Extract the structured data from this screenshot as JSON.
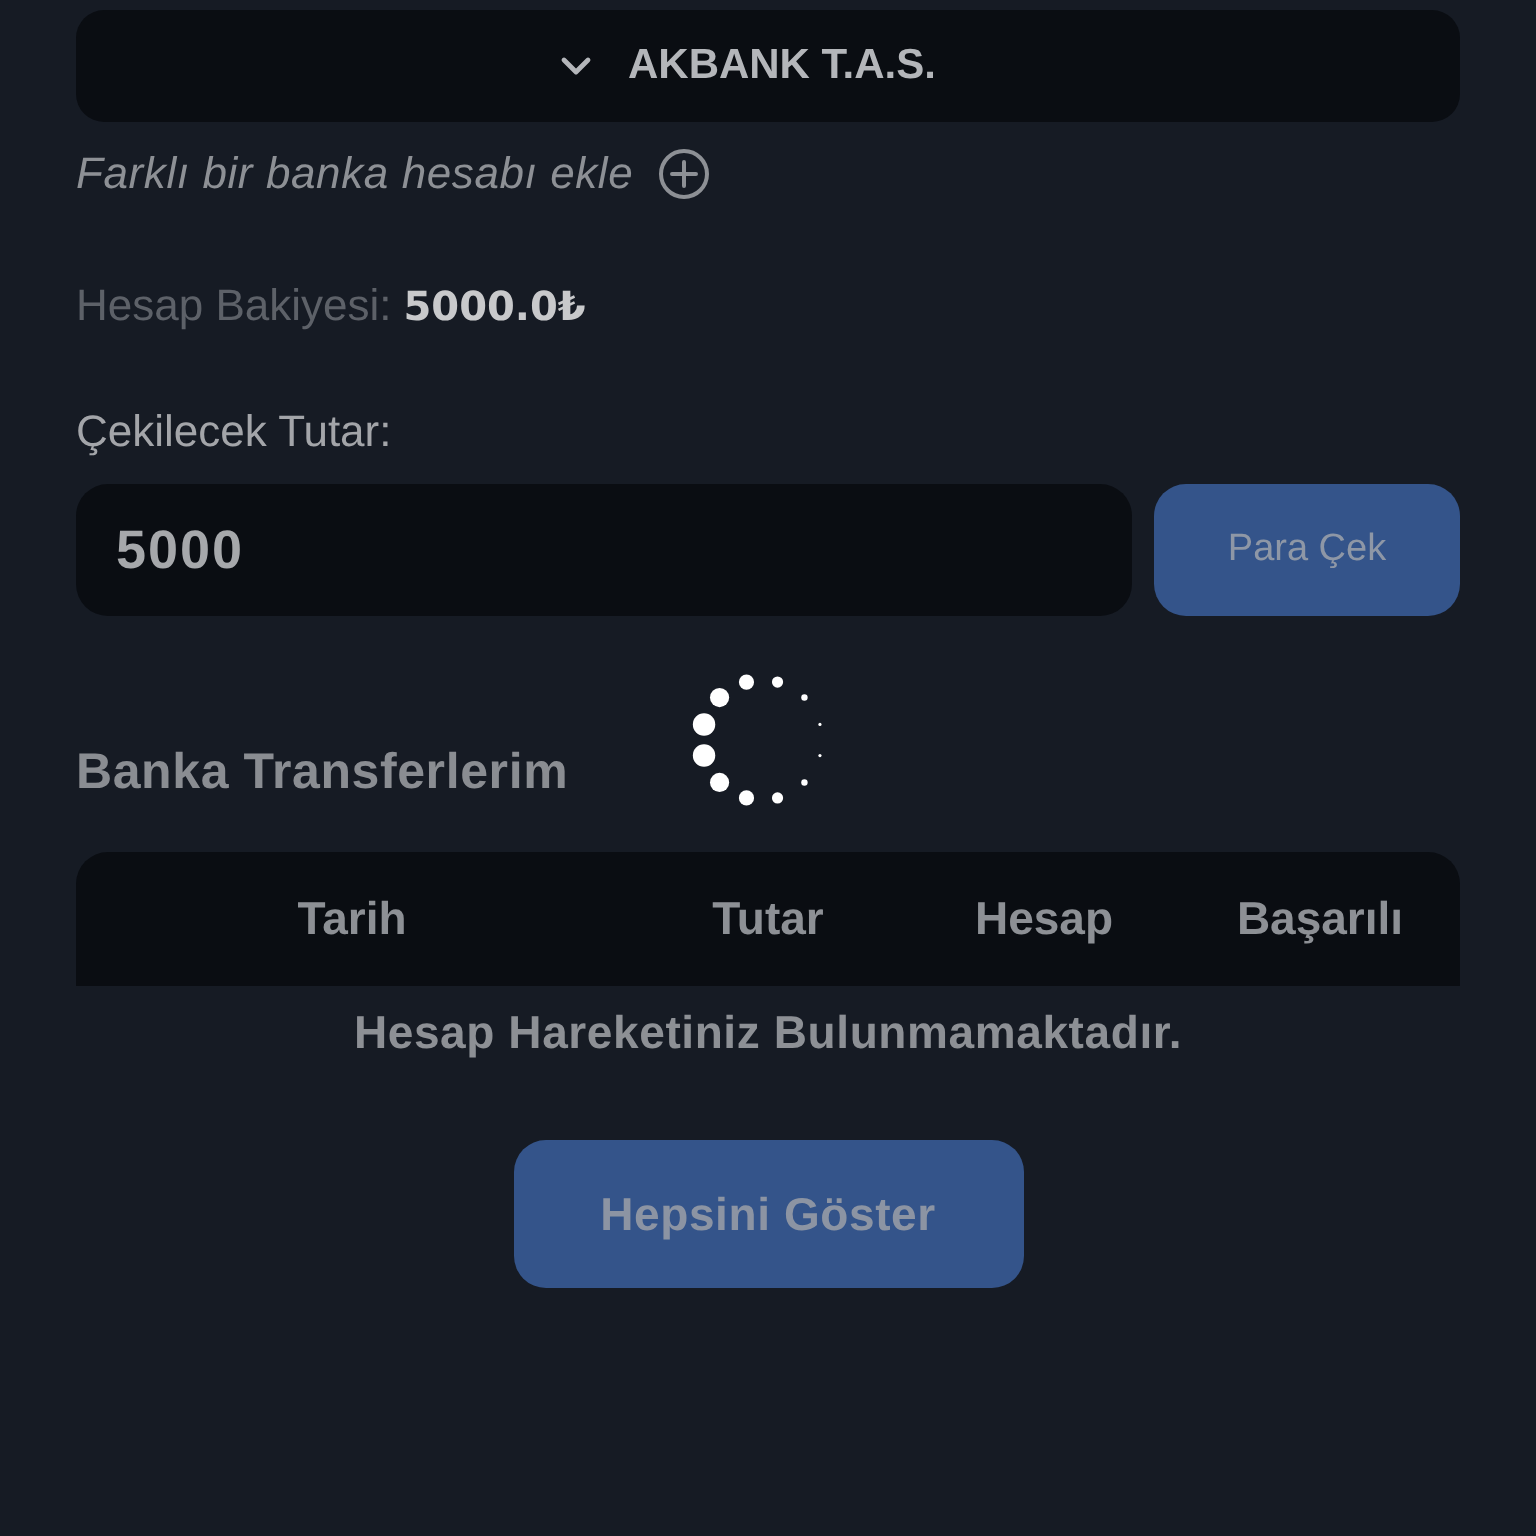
{
  "bank_select": {
    "value": "AKBANK T.A.S.",
    "expanded": false
  },
  "add_account_link": "Farklı bir banka hesabı ekle",
  "balance": {
    "label": "Hesap Bakiyesi:",
    "value": "5000.0₺"
  },
  "amount": {
    "label": "Çekilecek Tutar:",
    "value": "5000"
  },
  "withdraw_button": "Para Çek",
  "transfers": {
    "title": "Banka Transferlerim",
    "loading": true,
    "columns": [
      "Tarih",
      "Tutar",
      "Hesap",
      "Başarılı"
    ],
    "empty_message": "Hesap Hareketiniz Bulunmamaktadır."
  },
  "show_all_button": "Hepsini Göster"
}
